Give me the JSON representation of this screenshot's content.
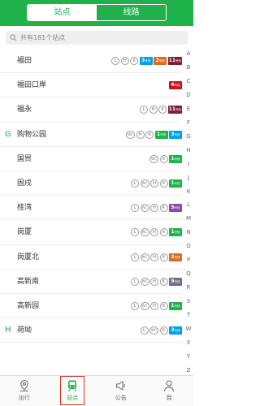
{
  "colors": {
    "accent": "#1fb24a",
    "highlight": "#e0302a"
  },
  "header": {
    "tabs": [
      "站点",
      "线路"
    ],
    "active_tab": 0
  },
  "search": {
    "placeholder": "共有181个站点",
    "icon": "search-icon"
  },
  "stations": [
    {
      "letter": "",
      "name": "福田",
      "icons": [
        "L",
        "H",
        "K"
      ],
      "badges": [
        {
          "num": "3",
          "color": "#00a0e9"
        },
        {
          "num": "2",
          "color": "#e06a1f"
        },
        {
          "num": "11",
          "color": "#7a2030"
        }
      ]
    },
    {
      "letter": "",
      "name": "福田口岸",
      "icons": [],
      "badges": [
        {
          "num": "4",
          "color": "#c8161e"
        }
      ]
    },
    {
      "letter": "",
      "name": "福永",
      "icons": [
        "L",
        "H",
        "K"
      ],
      "badges": [
        {
          "num": "11",
          "color": "#7a2030"
        }
      ]
    },
    {
      "letter": "G",
      "name": "购物公园",
      "icons": [
        "WC",
        "H",
        "K"
      ],
      "badges": [
        {
          "num": "1",
          "color": "#1fb24a"
        },
        {
          "num": "3",
          "color": "#00a0e9"
        }
      ]
    },
    {
      "letter": "",
      "name": "国贸",
      "icons": [
        "WC",
        "K"
      ],
      "badges": [
        {
          "num": "1",
          "color": "#1fb24a"
        }
      ]
    },
    {
      "letter": "",
      "name": "固戍",
      "icons": [
        "L",
        "WC",
        "H",
        "K"
      ],
      "badges": [
        {
          "num": "1",
          "color": "#1fb24a"
        }
      ]
    },
    {
      "letter": "",
      "name": "桂湾",
      "icons": [
        "L",
        "WC",
        "H",
        "K"
      ],
      "badges": [
        {
          "num": "5",
          "color": "#8c4aa8"
        }
      ]
    },
    {
      "letter": "",
      "name": "岗厦",
      "icons": [
        "L",
        "WC",
        "H",
        "K"
      ],
      "badges": [
        {
          "num": "1",
          "color": "#1fb24a"
        }
      ]
    },
    {
      "letter": "",
      "name": "岗厦北",
      "icons": [
        "L",
        "WC",
        "H",
        "K"
      ],
      "badges": [
        {
          "num": "2",
          "color": "#e06a1f"
        }
      ]
    },
    {
      "letter": "",
      "name": "高新南",
      "icons": [
        "L",
        "WC",
        "H",
        "K"
      ],
      "badges": [
        {
          "num": "9",
          "color": "#7a6a8a"
        }
      ]
    },
    {
      "letter": "",
      "name": "高新园",
      "icons": [
        "L",
        "WC",
        "H",
        "K"
      ],
      "badges": [
        {
          "num": "1",
          "color": "#1fb24a"
        }
      ]
    },
    {
      "letter": "H",
      "name": "荷坳",
      "icons": [
        "L",
        "WC",
        "K"
      ],
      "badges": [
        {
          "num": "3",
          "color": "#00a0e9"
        }
      ]
    }
  ],
  "badge_suffix": "号线",
  "index_letters": [
    "A",
    "B",
    "C",
    "D",
    "E",
    "F",
    "G",
    "H",
    "I",
    "J",
    "K",
    "L",
    "M",
    "N",
    "O",
    "P",
    "Q",
    "R",
    "S",
    "T",
    "W",
    "X",
    "Y",
    "Z"
  ],
  "nav": [
    {
      "label": "出行",
      "icon": "travel-icon"
    },
    {
      "label": "站点",
      "icon": "train-icon",
      "active": true
    },
    {
      "label": "公告",
      "icon": "megaphone-icon"
    },
    {
      "label": "我",
      "icon": "person-icon"
    }
  ]
}
